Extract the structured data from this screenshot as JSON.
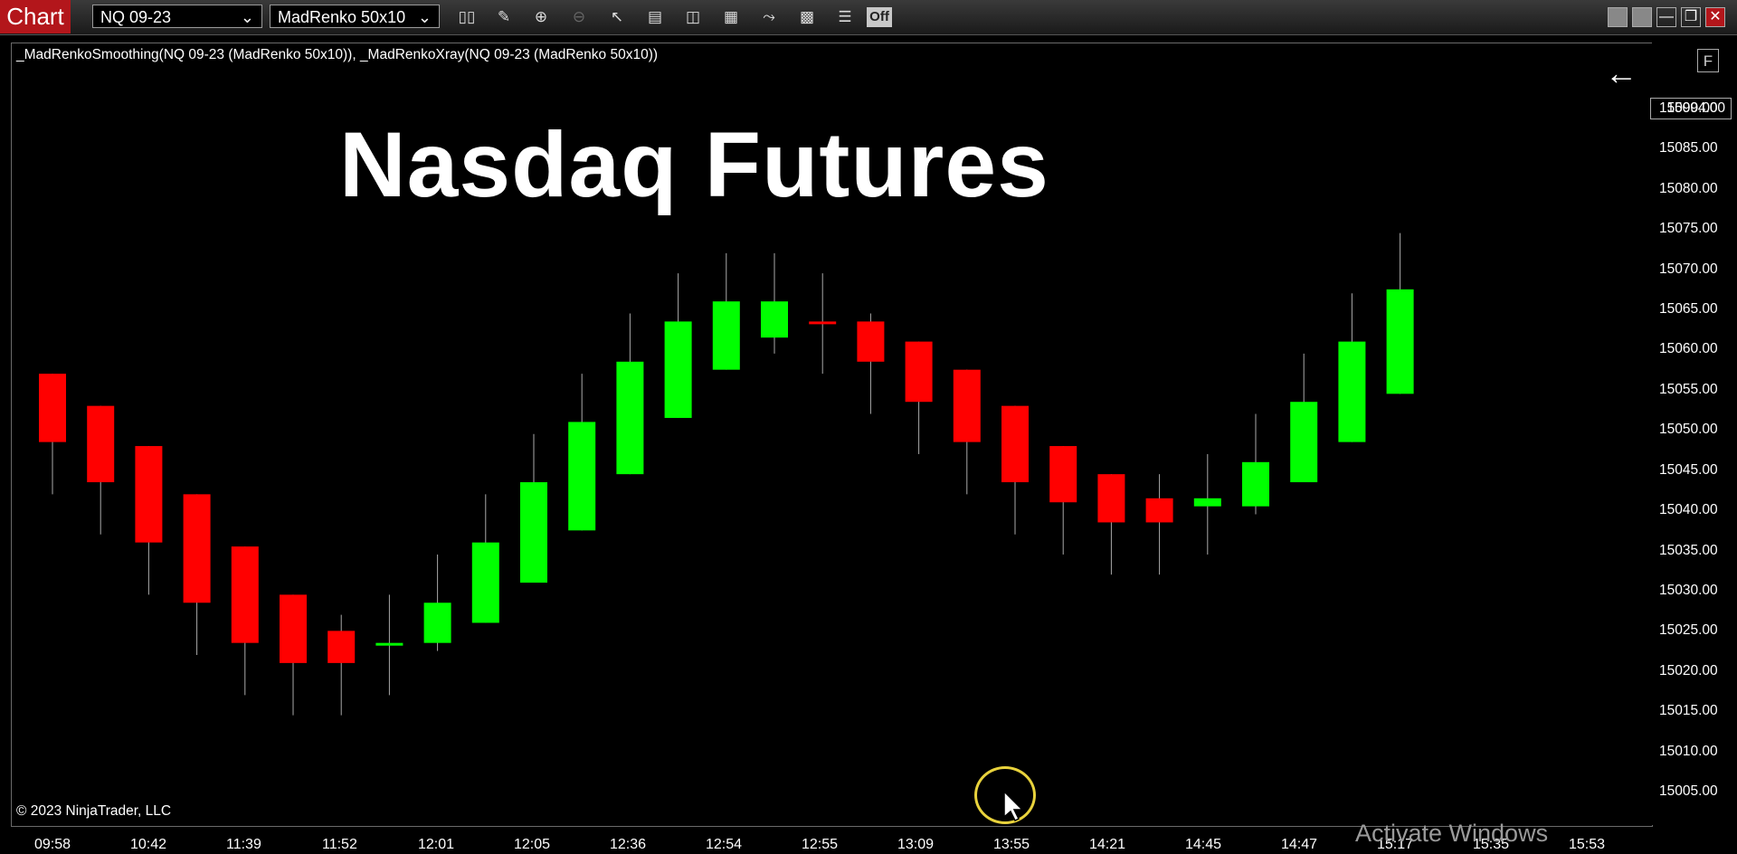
{
  "toolbar": {
    "tab_label": "Chart",
    "instrument": "NQ 09-23",
    "bar_type": "MadRenko 50x10",
    "tools": [
      "bar-type-icon",
      "pencil-draw-icon",
      "zoom-in-icon",
      "zoom-out-icon",
      "pointer-icon",
      "data-box-icon",
      "chart-style-icon",
      "chart-properties-icon",
      "drawing-tools-icon",
      "strategy-icon",
      "indicator-list-icon"
    ],
    "off_label": "Off",
    "window_controls": [
      "tile-icon",
      "tile-icon",
      "minimize-icon",
      "restore-icon",
      "close-icon"
    ]
  },
  "chart": {
    "indicator_label": "_MadRenkoSmoothing(NQ 09-23 (MadRenko 50x10)), _MadRenkoXray(NQ 09-23 (MadRenko 50x10))",
    "overlay_title": "Nasdaq Futures",
    "copyright": "© 2023 NinjaTrader, LLC",
    "f_button": "F",
    "watermark": "Activate Windows",
    "colors": {
      "up": "#00ff00",
      "down": "#ff0000",
      "background": "#000000"
    }
  },
  "chart_data": {
    "type": "candlestick",
    "price_labels": [
      "15090.00",
      "15085.00",
      "15080.00",
      "15075.00",
      "15070.00",
      "15065.00",
      "15060.00",
      "15055.00",
      "15050.00",
      "15045.00",
      "15040.00",
      "15035.00",
      "15030.00",
      "15025.00",
      "15020.00",
      "15015.00",
      "15010.00",
      "15005.00"
    ],
    "last_price": "15094.00",
    "time_labels": [
      "09:58",
      "10:42",
      "11:39",
      "11:52",
      "12:01",
      "12:05",
      "12:36",
      "12:54",
      "12:55",
      "13:09",
      "13:55",
      "14:21",
      "14:45",
      "14:47",
      "15:17",
      "15:35",
      "15:53"
    ],
    "ylim": [
      15002,
      15096
    ],
    "candles": [
      {
        "o": 15057,
        "c": 15048.5,
        "h": 15057,
        "l": 15042,
        "dir": "down"
      },
      {
        "o": 15053,
        "c": 15043.5,
        "h": 15053,
        "l": 15037,
        "dir": "down"
      },
      {
        "o": 15048,
        "c": 15036,
        "h": 15048,
        "l": 15029.5,
        "dir": "down"
      },
      {
        "o": 15042,
        "c": 15028.5,
        "h": 15042,
        "l": 15022,
        "dir": "down"
      },
      {
        "o": 15035.5,
        "c": 15023.5,
        "h": 15035.5,
        "l": 15017,
        "dir": "down"
      },
      {
        "o": 15029.5,
        "c": 15021,
        "h": 15029.5,
        "l": 15014.5,
        "dir": "down"
      },
      {
        "o": 15025,
        "c": 15021,
        "h": 15027,
        "l": 15014.5,
        "dir": "down"
      },
      {
        "o": 15023.5,
        "c": 15023.5,
        "h": 15029.5,
        "l": 15017,
        "dir": "up"
      },
      {
        "o": 15023.5,
        "c": 15028.5,
        "h": 15034.5,
        "l": 15022.5,
        "dir": "up"
      },
      {
        "o": 15026,
        "c": 15036,
        "h": 15042,
        "l": 15026,
        "dir": "up"
      },
      {
        "o": 15031,
        "c": 15043.5,
        "h": 15049.5,
        "l": 15031,
        "dir": "up"
      },
      {
        "o": 15037.5,
        "c": 15051,
        "h": 15057,
        "l": 15037.5,
        "dir": "up"
      },
      {
        "o": 15044.5,
        "c": 15058.5,
        "h": 15064.5,
        "l": 15044.5,
        "dir": "up"
      },
      {
        "o": 15051.5,
        "c": 15063.5,
        "h": 15069.5,
        "l": 15051.5,
        "dir": "up"
      },
      {
        "o": 15057.5,
        "c": 15066,
        "h": 15072,
        "l": 15057.5,
        "dir": "up"
      },
      {
        "o": 15061.5,
        "c": 15066,
        "h": 15072,
        "l": 15059.5,
        "dir": "up"
      },
      {
        "o": 15063.5,
        "c": 15063.5,
        "h": 15069.5,
        "l": 15057,
        "dir": "down"
      },
      {
        "o": 15063.5,
        "c": 15058.5,
        "h": 15064.5,
        "l": 15052,
        "dir": "down"
      },
      {
        "o": 15061,
        "c": 15053.5,
        "h": 15061,
        "l": 15047,
        "dir": "down"
      },
      {
        "o": 15057.5,
        "c": 15048.5,
        "h": 15057.5,
        "l": 15042,
        "dir": "down"
      },
      {
        "o": 15053,
        "c": 15043.5,
        "h": 15053,
        "l": 15037,
        "dir": "down"
      },
      {
        "o": 15048,
        "c": 15041,
        "h": 15048,
        "l": 15034.5,
        "dir": "down"
      },
      {
        "o": 15044.5,
        "c": 15038.5,
        "h": 15044.5,
        "l": 15032,
        "dir": "down"
      },
      {
        "o": 15041.5,
        "c": 15038.5,
        "h": 15044.5,
        "l": 15032,
        "dir": "down"
      },
      {
        "o": 15040.5,
        "c": 15041.5,
        "h": 15047,
        "l": 15034.5,
        "dir": "up"
      },
      {
        "o": 15040.5,
        "c": 15046,
        "h": 15052,
        "l": 15039.5,
        "dir": "up"
      },
      {
        "o": 15043.5,
        "c": 15053.5,
        "h": 15059.5,
        "l": 15043.5,
        "dir": "up"
      },
      {
        "o": 15048.5,
        "c": 15061,
        "h": 15067,
        "l": 15048.5,
        "dir": "up"
      },
      {
        "o": 15054.5,
        "c": 15067.5,
        "h": 15074.5,
        "l": 15054.5,
        "dir": "up"
      }
    ]
  }
}
